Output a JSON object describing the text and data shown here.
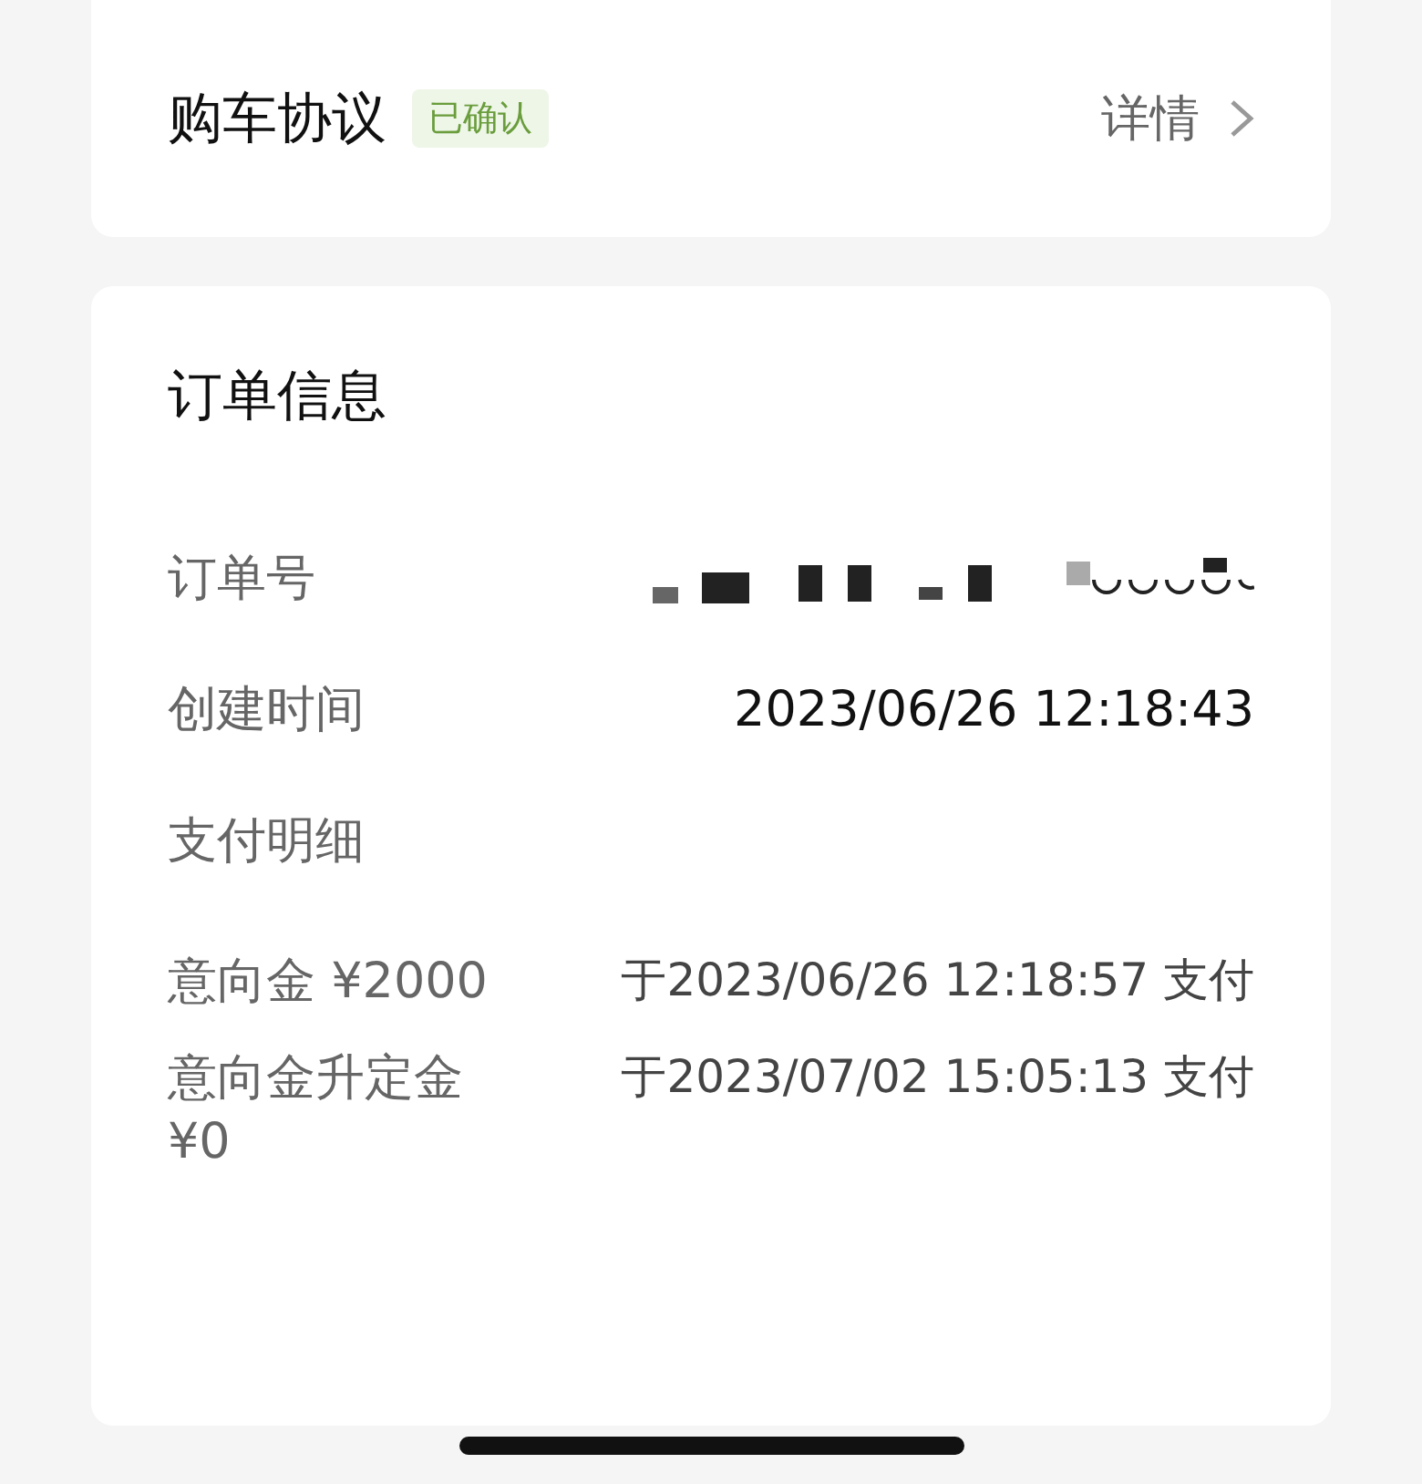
{
  "agreement": {
    "title": "购车协议",
    "badge": "已确认",
    "link": "详情"
  },
  "order": {
    "title": "订单信息",
    "rows": [
      {
        "kind": "redacted",
        "label": "订单号"
      },
      {
        "kind": "text",
        "label": "创建时间",
        "value": "2023/06/26 12:18:43"
      }
    ],
    "payment_title": "支付明细",
    "payments": [
      {
        "label": "意向金 ¥2000",
        "value": "于2023/06/26 12:18:57 支付"
      },
      {
        "label": "意向金升定金 ¥0",
        "value": "于2023/07/02 15:05:13 支付"
      }
    ]
  }
}
